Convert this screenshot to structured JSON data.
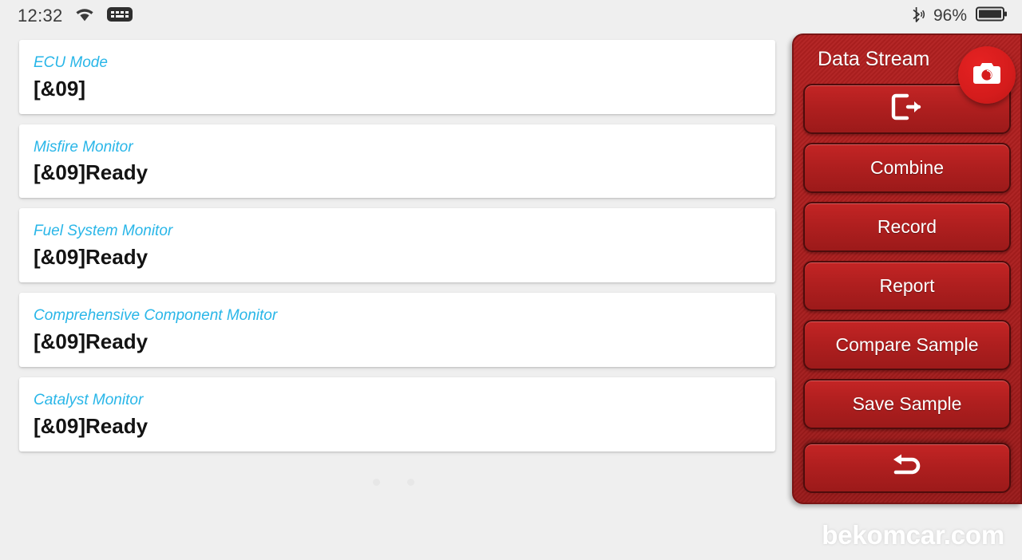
{
  "status_bar": {
    "time": "12:32",
    "wifi_icon": "wifi-icon",
    "keyboard_icon": "keyboard-icon",
    "bluetooth_icon": "bluetooth-icon",
    "battery_percent": "96%",
    "battery_icon": "battery-icon"
  },
  "list": {
    "items": [
      {
        "title": "ECU Mode",
        "value": "[&09]"
      },
      {
        "title": "Misfire Monitor",
        "value": "[&09]Ready"
      },
      {
        "title": "Fuel System Monitor",
        "value": "[&09]Ready"
      },
      {
        "title": "Comprehensive Component Monitor",
        "value": "[&09]Ready"
      },
      {
        "title": "Catalyst Monitor",
        "value": "[&09]Ready"
      }
    ]
  },
  "panel": {
    "title": "Data Stream",
    "camera_icon": "camera-icon",
    "buttons": [
      {
        "label": "",
        "icon": "exit-icon"
      },
      {
        "label": "Combine",
        "icon": ""
      },
      {
        "label": "Record",
        "icon": ""
      },
      {
        "label": "Report",
        "icon": ""
      },
      {
        "label": "Compare Sample",
        "icon": ""
      },
      {
        "label": "Save Sample",
        "icon": ""
      }
    ],
    "back_button": {
      "label": "",
      "icon": "back-arrow-icon"
    }
  },
  "watermark": "bekomcar.com",
  "colors": {
    "accent_cyan": "#29b6e8",
    "panel_red": "#a81d1d",
    "button_red": "#b01f1f",
    "camera_red": "#d51c1c",
    "page_bg": "#efefef"
  }
}
